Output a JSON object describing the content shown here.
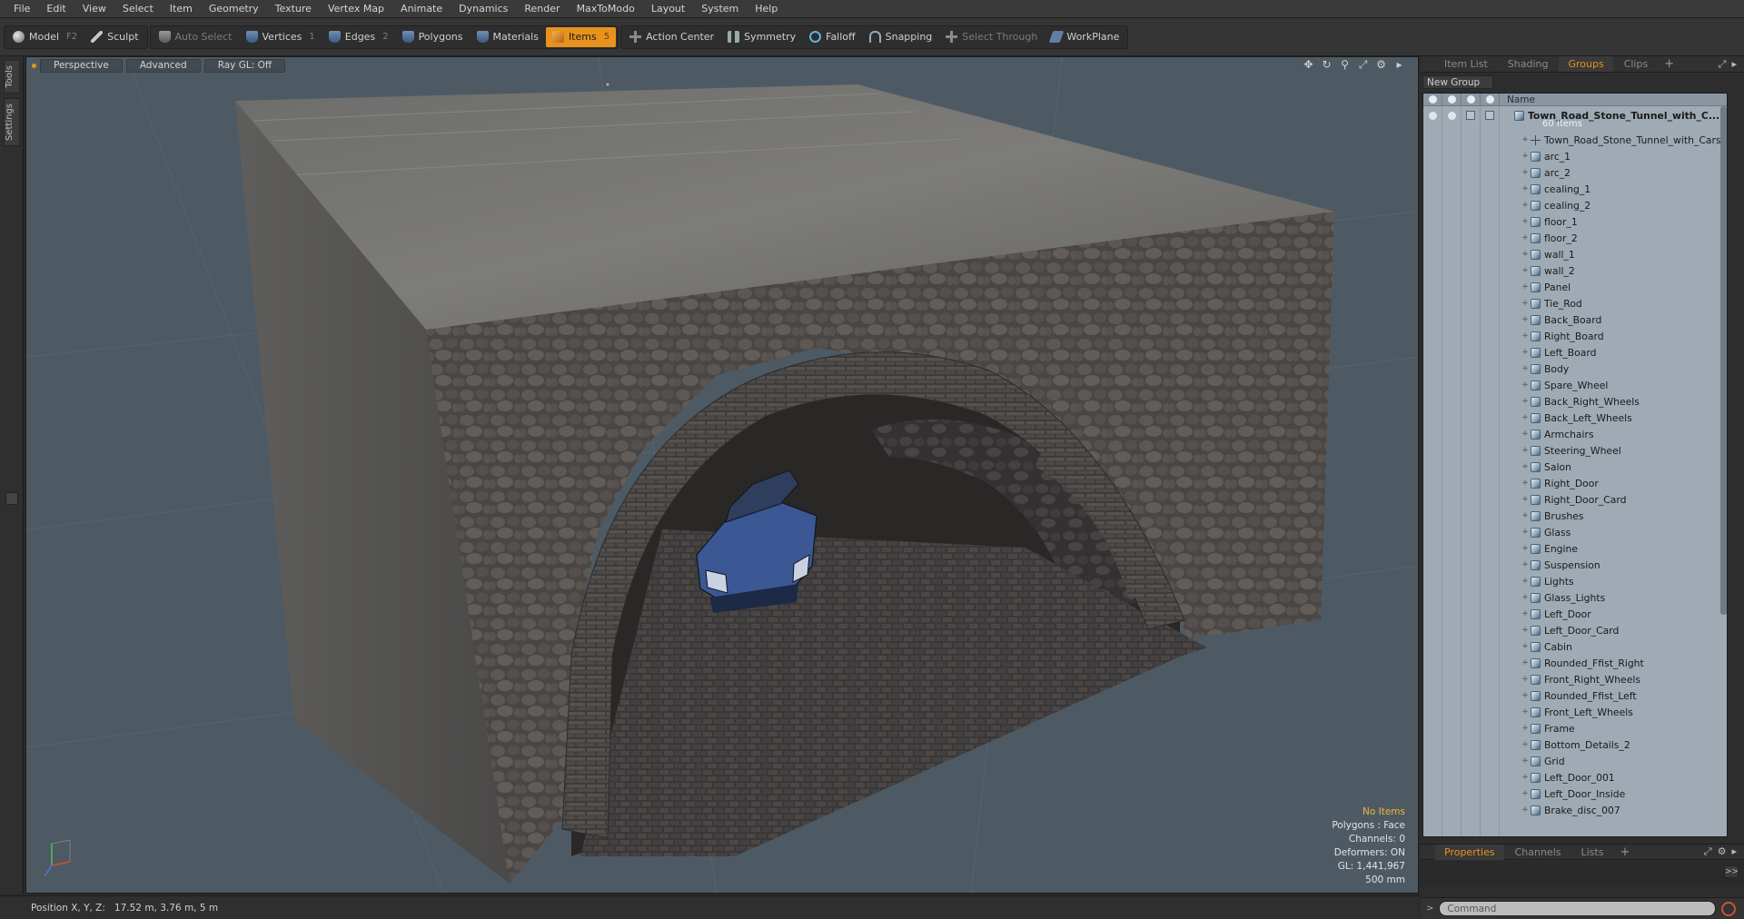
{
  "menu": [
    "File",
    "Edit",
    "View",
    "Select",
    "Item",
    "Geometry",
    "Texture",
    "Vertex Map",
    "Animate",
    "Dynamics",
    "Render",
    "MaxToModo",
    "Layout",
    "System",
    "Help"
  ],
  "toolbar": {
    "model_label": "Model",
    "model_key": "F2",
    "sculpt_label": "Sculpt",
    "auto_select_label": "Auto Select",
    "vertices_label": "Vertices",
    "vertices_key": "1",
    "edges_label": "Edges",
    "edges_key": "2",
    "polygons_label": "Polygons",
    "materials_label": "Materials",
    "items_label": "Items",
    "items_key": "5",
    "action_center_label": "Action Center",
    "symmetry_label": "Symmetry",
    "falloff_label": "Falloff",
    "snapping_label": "Snapping",
    "select_through_label": "Select Through",
    "workplane_label": "WorkPlane",
    "accent_color": "#e8921e"
  },
  "left_tabs": [
    "Tools",
    "Settings"
  ],
  "viewport": {
    "perspective_label": "Perspective",
    "advanced_label": "Advanced",
    "raygl_label": "Ray GL: Off",
    "hud": {
      "selection": "No Items",
      "polygons": "Polygons : Face",
      "channels": "Channels: 0",
      "deformers": "Deformers: ON",
      "gl": "GL: 1,441,967",
      "unit": "500 mm"
    },
    "background_color": "#4e5a63"
  },
  "right_panel": {
    "tabs": [
      "Item List",
      "Shading",
      "Groups",
      "Clips"
    ],
    "active_tab": "Groups",
    "new_group_label": "New Group",
    "name_header": "Name",
    "root_name": "Town_Road_Stone_Tunnel_with_C...",
    "root_count": "60 Items",
    "items": [
      "Town_Road_Stone_Tunnel_with_Cars",
      "arc_1",
      "arc_2",
      "cealing_1",
      "cealing_2",
      "floor_1",
      "floor_2",
      "wall_1",
      "wall_2",
      "Panel",
      "Tie_Rod",
      "Back_Board",
      "Right_Board",
      "Left_Board",
      "Body",
      "Spare_Wheel",
      "Back_Right_Wheels",
      "Back_Left_Wheels",
      "Armchairs",
      "Steering_Wheel",
      "Salon",
      "Right_Door",
      "Right_Door_Card",
      "Brushes",
      "Glass",
      "Engine",
      "Suspension",
      "Lights",
      "Glass_Lights",
      "Left_Door",
      "Left_Door_Card",
      "Cabin",
      "Rounded_Ffist_Right",
      "Front_Right_Wheels",
      "Rounded_Ffist_Left",
      "Front_Left_Wheels",
      "Frame",
      "Bottom_Details_2",
      "Grid",
      "Left_Door_001",
      "Left_Door_Inside",
      "Brake_disc_007"
    ],
    "props_tabs": [
      "Properties",
      "Channels",
      "Lists"
    ],
    "props_active": "Properties",
    "command_placeholder": "Command"
  },
  "status": {
    "position_label": "Position X, Y, Z:",
    "position_value": "17.52 m, 3.76 m, 5 m"
  }
}
